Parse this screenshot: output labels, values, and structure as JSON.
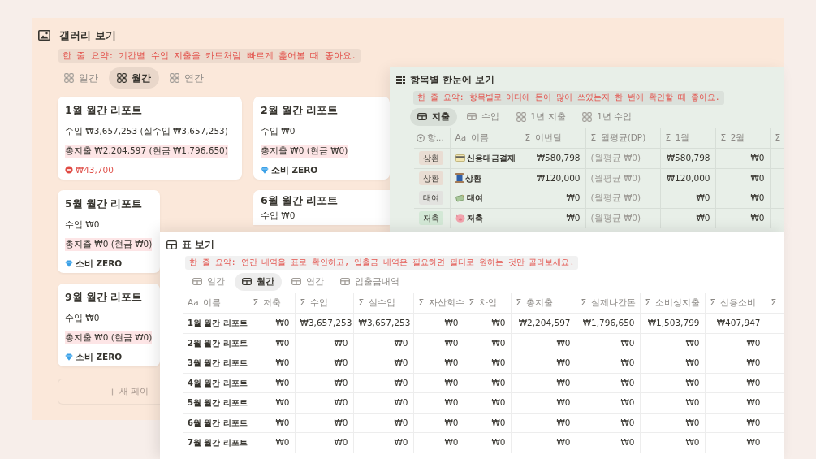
{
  "gallery": {
    "title": "갤러리 보기",
    "summary": "한 줄 요약: 기간별 수입 지출을 카드처럼 빠르게 훑어볼 때 좋아요.",
    "tabs": [
      {
        "label": "일간",
        "selected": false
      },
      {
        "label": "월간",
        "selected": true
      },
      {
        "label": "연간",
        "selected": false
      }
    ],
    "cards": [
      {
        "title": "1월 월간 리포트",
        "lines": [
          {
            "kind": "income",
            "text": "수입 ₩3,657,253 (실수입 ₩3,657,253)"
          },
          {
            "kind": "expense",
            "text": "총지출 ₩2,204,597 (현금 ₩1,796,650)"
          },
          {
            "kind": "deficit",
            "text": "₩43,700"
          }
        ]
      },
      {
        "title": "2월 월간 리포트",
        "lines": [
          {
            "kind": "income",
            "text": "수입 ₩0"
          },
          {
            "kind": "expense",
            "text": "총지출 ₩0 (현금 ₩0)"
          },
          {
            "kind": "zero",
            "text": "소비 ZERO"
          }
        ]
      },
      {
        "title": "5월 월간 리포트",
        "lines": [
          {
            "kind": "income",
            "text": "수입 ₩0"
          },
          {
            "kind": "expense",
            "text": "총지출 ₩0 (현금 ₩0)"
          },
          {
            "kind": "zero",
            "text": "소비 ZERO"
          }
        ]
      },
      {
        "title": "6월 월간 리포트",
        "lines": [
          {
            "kind": "income",
            "text": "수입 ₩0"
          }
        ]
      },
      {
        "title": "9월 월간 리포트",
        "lines": [
          {
            "kind": "income",
            "text": "수입 ₩0"
          },
          {
            "kind": "expense",
            "text": "총지출 ₩0 (현금 ₩0)"
          },
          {
            "kind": "zero",
            "text": "소비 ZERO"
          }
        ]
      }
    ],
    "new_page": "새 페이"
  },
  "items_view": {
    "title": "항목별 한눈에 보기",
    "summary": "한 줄 요약: 항목별로 어디에 돈이 많이 쓰였는지 한 번에 확인할 때 좋아요.",
    "tabs": [
      {
        "label": "지출",
        "selected": true,
        "kind": "table"
      },
      {
        "label": "수입",
        "selected": false,
        "kind": "table"
      },
      {
        "label": "1년 지출",
        "selected": false,
        "kind": "gallery"
      },
      {
        "label": "1년 수입",
        "selected": false,
        "kind": "gallery"
      }
    ],
    "columns": [
      {
        "kind": "select",
        "label": "항..."
      },
      {
        "kind": "title",
        "mark": "Aa",
        "label": "이름"
      },
      {
        "kind": "sum",
        "mark": "Σ",
        "label": "이번달"
      },
      {
        "kind": "sum",
        "mark": "Σ",
        "label": "월평균(DP)"
      },
      {
        "kind": "sum",
        "mark": "Σ",
        "label": "1월"
      },
      {
        "kind": "sum",
        "mark": "Σ",
        "label": "2월"
      },
      {
        "kind": "sum",
        "mark": "Σ"
      }
    ],
    "rows": [
      {
        "tag": "상환",
        "color": "#e9ddd3",
        "kind": "card",
        "name": "신용대금결제",
        "values": [
          "₩580,798",
          "(월평균 ₩0)",
          "₩580,798",
          "₩0"
        ]
      },
      {
        "tag": "상환",
        "color": "#e9ddd3",
        "kind": "spool",
        "name": "상환",
        "values": [
          "₩120,000",
          "(월평균 ₩0)",
          "₩120,000",
          "₩0"
        ]
      },
      {
        "tag": "대여",
        "color": "#e2e2df",
        "kind": "money",
        "name": "대여",
        "values": [
          "₩0",
          "(월평균 ₩0)",
          "₩0",
          "₩0"
        ]
      },
      {
        "tag": "저축",
        "color": "#d3e8d6",
        "kind": "pig",
        "name": "저축",
        "values": [
          "₩0",
          "(월평균 ₩0)",
          "₩0",
          "₩0"
        ]
      }
    ]
  },
  "table_view": {
    "title": "표 보기",
    "summary": "한 줄 요약: 연간 내역을 표로 확인하고, 입출금 내역은 필요하면 필터로 원하는 것만 골라보세요.",
    "tabs": [
      {
        "label": "일간",
        "selected": false
      },
      {
        "label": "월간",
        "selected": true
      },
      {
        "label": "연간",
        "selected": false
      },
      {
        "label": "입출금내역",
        "selected": false
      }
    ],
    "columns": [
      {
        "mark": "Aa",
        "label": "이름"
      },
      {
        "mark": "Σ",
        "label": "저축"
      },
      {
        "mark": "Σ",
        "label": "수입"
      },
      {
        "mark": "Σ",
        "label": "실수입"
      },
      {
        "mark": "Σ",
        "label": "자산회수"
      },
      {
        "mark": "Σ",
        "label": "차입"
      },
      {
        "mark": "Σ",
        "label": "총지출"
      },
      {
        "mark": "Σ",
        "label": "실제나간돈"
      },
      {
        "mark": "Σ",
        "label": "소비성지출"
      },
      {
        "mark": "Σ",
        "label": "신용소비"
      },
      {
        "mark": "Σ"
      }
    ],
    "rows": [
      {
        "name": "1월 월간 리포트",
        "values": [
          "₩0",
          "₩3,657,253",
          "₩3,657,253",
          "₩0",
          "₩0",
          "₩2,204,597",
          "₩1,796,650",
          "₩1,503,799",
          "₩407,947"
        ]
      },
      {
        "name": "2월 월간 리포트",
        "values": [
          "₩0",
          "₩0",
          "₩0",
          "₩0",
          "₩0",
          "₩0",
          "₩0",
          "₩0",
          "₩0"
        ]
      },
      {
        "name": "3월 월간 리포트",
        "values": [
          "₩0",
          "₩0",
          "₩0",
          "₩0",
          "₩0",
          "₩0",
          "₩0",
          "₩0",
          "₩0"
        ]
      },
      {
        "name": "4월 월간 리포트",
        "values": [
          "₩0",
          "₩0",
          "₩0",
          "₩0",
          "₩0",
          "₩0",
          "₩0",
          "₩0",
          "₩0"
        ]
      },
      {
        "name": "5월 월간 리포트",
        "values": [
          "₩0",
          "₩0",
          "₩0",
          "₩0",
          "₩0",
          "₩0",
          "₩0",
          "₩0",
          "₩0"
        ]
      },
      {
        "name": "6월 월간 리포트",
        "values": [
          "₩0",
          "₩0",
          "₩0",
          "₩0",
          "₩0",
          "₩0",
          "₩0",
          "₩0",
          "₩0"
        ]
      },
      {
        "name": "7월 월간 리포트",
        "values": [
          "₩0",
          "₩0",
          "₩0",
          "₩0",
          "₩0",
          "₩0",
          "₩0",
          "₩0",
          "₩0"
        ]
      }
    ]
  }
}
